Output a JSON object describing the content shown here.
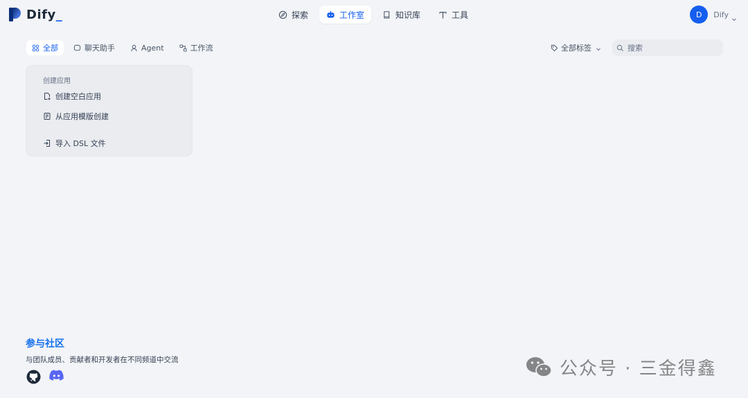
{
  "app": {
    "logo_text": "Dify",
    "logo_suffix": "_"
  },
  "nav": {
    "items": [
      {
        "label": "探索",
        "icon": "explore-icon"
      },
      {
        "label": "工作室",
        "icon": "studio-icon",
        "active": true
      },
      {
        "label": "知识库",
        "icon": "knowledge-icon"
      },
      {
        "label": "工具",
        "icon": "tools-icon"
      }
    ]
  },
  "user": {
    "initial": "D",
    "name": "Dify"
  },
  "tabs": [
    {
      "label": "全部",
      "icon": "grid-icon",
      "active": true
    },
    {
      "label": "聊天助手",
      "icon": "chat-icon"
    },
    {
      "label": "Agent",
      "icon": "agent-icon"
    },
    {
      "label": "工作流",
      "icon": "workflow-icon"
    }
  ],
  "filter": {
    "tags_label": "全部标签",
    "search_placeholder": "搜索"
  },
  "create_card": {
    "heading": "创建应用",
    "items": [
      {
        "label": "创建空白应用",
        "icon": "new-file-icon"
      },
      {
        "label": "从应用模版创建",
        "icon": "template-icon"
      },
      {
        "label": "导入 DSL 文件",
        "icon": "import-icon"
      }
    ]
  },
  "community": {
    "title": "参与社区",
    "description": "与团队成员、贡献者和开发者在不同频道中交流",
    "links": [
      "github-icon",
      "discord-icon"
    ]
  },
  "watermark": {
    "text": "公众号 · 三金得鑫"
  },
  "colors": {
    "accent": "#155eef",
    "background": "#f2f4f7",
    "community_title": "#1570ef"
  }
}
